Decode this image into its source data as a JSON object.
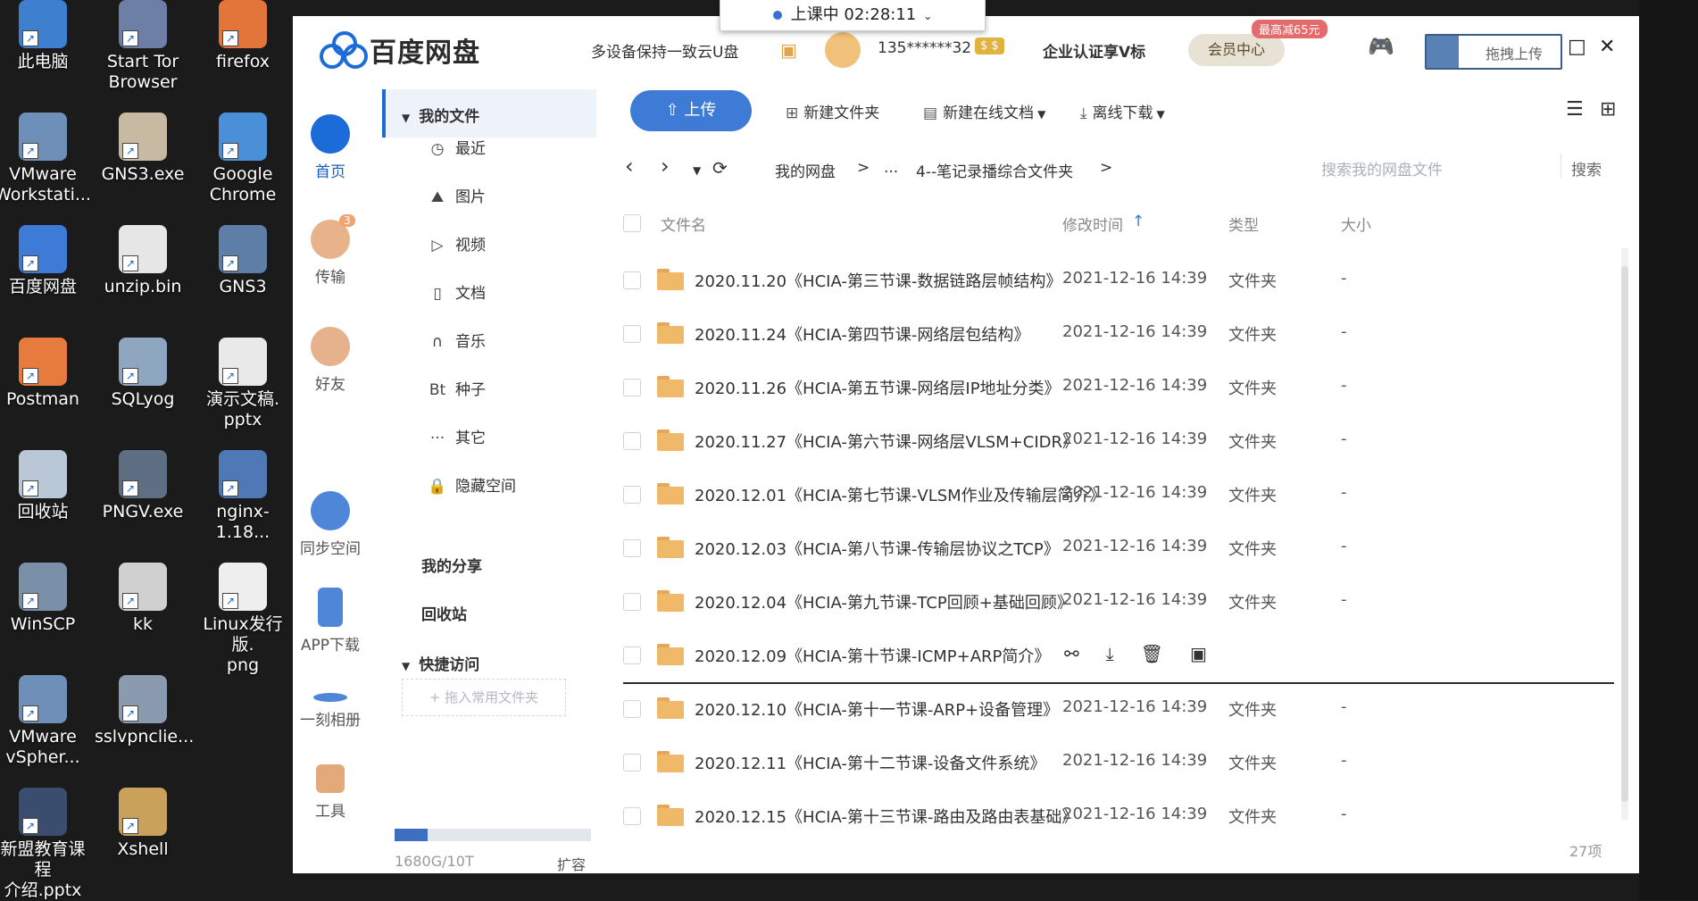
{
  "timer": {
    "text": "上课中 02:28:11"
  },
  "desktop": {
    "icons": [
      {
        "label": "此电脑",
        "icon": "computer-icon",
        "color": "#3f7fd0"
      },
      {
        "label": "Start Tor\nBrowser",
        "icon": "tor-browser-icon",
        "color": "#6d7fa6"
      },
      {
        "label": "firefox",
        "icon": "firefox-icon",
        "color": "#e3743a"
      },
      {
        "label": "VMware\nWorkstati...",
        "icon": "vmware-icon",
        "color": "#6e8fb8"
      },
      {
        "label": "GNS3.exe",
        "icon": "gns3-exe-icon",
        "color": "#c7b9a2"
      },
      {
        "label": "Google\nChrome",
        "icon": "chrome-icon",
        "color": "#4a90d9"
      },
      {
        "label": "百度网盘",
        "icon": "baidu-netdisk-icon",
        "color": "#3d7bd6"
      },
      {
        "label": "unzip.bin",
        "icon": "file-icon",
        "color": "#e6e6e6"
      },
      {
        "label": "GNS3",
        "icon": "gns3-icon",
        "color": "#5d7fa7"
      },
      {
        "label": "Postman",
        "icon": "postman-icon",
        "color": "#e77b3d"
      },
      {
        "label": "SQLyog",
        "icon": "sqlyog-icon",
        "color": "#8ea6bf"
      },
      {
        "label": "演示文稿.\npptx",
        "icon": "pptx-icon",
        "color": "#e9e9e9"
      },
      {
        "label": "回收站",
        "icon": "recycle-bin-icon",
        "color": "#b9c7d6"
      },
      {
        "label": "PNGV.exe",
        "icon": "pngv-icon",
        "color": "#5e6f83"
      },
      {
        "label": "nginx-1.18...",
        "icon": "archive-icon",
        "color": "#4e78b6"
      },
      {
        "label": "WinSCP",
        "icon": "winscp-icon",
        "color": "#7a8fa8"
      },
      {
        "label": "kk",
        "icon": "kk-icon",
        "color": "#d0d0d0"
      },
      {
        "label": "Linux发行版.\npng",
        "icon": "png-file-icon",
        "color": "#eeeeee"
      },
      {
        "label": "VMware\nvSpher...",
        "icon": "vsphere-icon",
        "color": "#6e8fb8"
      },
      {
        "label": "sslvpnclie...",
        "icon": "sslvpn-icon",
        "color": "#8a9bb0"
      },
      {
        "label": "新盟教育课程\n介绍.pptx",
        "icon": "pptx-icon",
        "color": "#3a4d6e"
      },
      {
        "label": "Xshell",
        "icon": "xshell-icon",
        "color": "#c9a15a"
      }
    ]
  },
  "app": {
    "logo_text": "百度网盘",
    "top": {
      "sync_promo": "多设备保持一致云U盘",
      "account": "135******32",
      "enterprise": "企业认证享V标",
      "vip_center": "会员中心",
      "vip_badge": "最高减65元",
      "drag_upload": "拖拽上传"
    },
    "leftnav": [
      {
        "label": "首页",
        "icon": "cloud-icon"
      },
      {
        "label": "传输",
        "icon": "transfer-icon",
        "badge": "3"
      },
      {
        "label": "好友",
        "icon": "friends-icon"
      },
      {
        "label": "同步空间",
        "icon": "sync-icon"
      },
      {
        "label": "APP下载",
        "icon": "phone-icon"
      },
      {
        "label": "一刻相册",
        "icon": "album-icon"
      },
      {
        "label": "工具",
        "icon": "tools-icon"
      }
    ],
    "side": {
      "my_files": "我的文件",
      "items": [
        {
          "label": "最近",
          "icon": "clock-icon",
          "glyph": "◷"
        },
        {
          "label": "图片",
          "icon": "image-icon",
          "glyph": "⛰"
        },
        {
          "label": "视频",
          "icon": "play-icon",
          "glyph": "▷"
        },
        {
          "label": "文档",
          "icon": "doc-icon",
          "glyph": "▯"
        },
        {
          "label": "音乐",
          "icon": "headphone-icon",
          "glyph": "∩"
        },
        {
          "label": "种子",
          "icon": "bt-icon",
          "glyph": "Bt"
        },
        {
          "label": "其它",
          "icon": "more-icon",
          "glyph": "···"
        },
        {
          "label": "隐藏空间",
          "icon": "lock-icon",
          "glyph": "🔒"
        }
      ],
      "my_share": "我的分享",
      "recycle": "回收站",
      "quick_access": "快捷访问",
      "quick_add": "+ 拖入常用文件夹",
      "storage_text": "1680G/10T",
      "storage_fraction": 0.168,
      "expand": "扩容"
    },
    "toolbar": {
      "upload": "上传",
      "new_folder": "新建文件夹",
      "new_online_doc": "新建在线文档",
      "offline_download": "离线下载"
    },
    "breadcrumb": {
      "root": "我的网盘",
      "ellipsis": "...",
      "current": "4--笔记录播综合文件夹",
      "sep": ">"
    },
    "search": {
      "placeholder": "搜索我的网盘文件",
      "button": "搜索"
    },
    "table": {
      "headers": {
        "name": "文件名",
        "time": "修改时间",
        "type": "类型",
        "size": "大小"
      },
      "rows": [
        {
          "name": "2020.11.20《HCIA-第三节课-数据链路层帧结构》",
          "time": "2021-12-16 14:39",
          "type": "文件夹",
          "size": "-"
        },
        {
          "name": "2020.11.24《HCIA-第四节课-网络层包结构》",
          "time": "2021-12-16 14:39",
          "type": "文件夹",
          "size": "-"
        },
        {
          "name": "2020.11.26《HCIA-第五节课-网络层IP地址分类》",
          "time": "2021-12-16 14:39",
          "type": "文件夹",
          "size": "-"
        },
        {
          "name": "2020.11.27《HCIA-第六节课-网络层VLSM+CIDR》",
          "time": "2021-12-16 14:39",
          "type": "文件夹",
          "size": "-"
        },
        {
          "name": "2020.12.01《HCIA-第七节课-VLSM作业及传输层简介》",
          "time": "2021-12-16 14:39",
          "type": "文件夹",
          "size": "-"
        },
        {
          "name": "2020.12.03《HCIA-第八节课-传输层协议之TCP》",
          "time": "2021-12-16 14:39",
          "type": "文件夹",
          "size": "-"
        },
        {
          "name": "2020.12.04《HCIA-第九节课-TCP回顾+基础回顾》",
          "time": "2021-12-16 14:39",
          "type": "文件夹",
          "size": "-"
        },
        {
          "name": "2020.12.09《HCIA-第十节课-ICMP+ARP简介》",
          "time": "",
          "type": "",
          "size": "",
          "hover": true
        },
        {
          "name": "2020.12.10《HCIA-第十一节课-ARP+设备管理》",
          "time": "2021-12-16 14:39",
          "type": "文件夹",
          "size": "-"
        },
        {
          "name": "2020.12.11《HCIA-第十二节课-设备文件系统》",
          "time": "2021-12-16 14:39",
          "type": "文件夹",
          "size": "-"
        },
        {
          "name": "2020.12.15《HCIA-第十三节课-路由及路由表基础》",
          "time": "2021-12-16 14:39",
          "type": "文件夹",
          "size": "-"
        }
      ]
    },
    "count": "27项"
  }
}
